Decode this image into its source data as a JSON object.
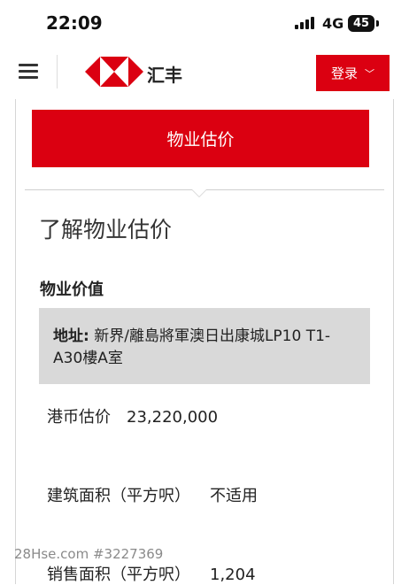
{
  "status_bar": {
    "time": "22:09",
    "network": "4G",
    "battery": "45"
  },
  "header": {
    "brand": "汇丰",
    "login_label": "登录"
  },
  "tab": {
    "label": "物业估价"
  },
  "section": {
    "title": "了解物业估价",
    "subheading": "物业价值"
  },
  "address": {
    "label": "地址:",
    "value": "新界/離島將軍澳日出康城LP10 T1-A30樓A室"
  },
  "rows": {
    "hkd_valuation": {
      "label": "港币估价",
      "value": "23,220,000"
    },
    "gross_area": {
      "label": "建筑面积（平方呎）",
      "value": "不适用"
    },
    "saleable_area": {
      "label": "销售面积（平方呎）",
      "value": "1,204"
    }
  },
  "watermark": "28Hse.com #3227369",
  "colors": {
    "brand_red": "#db0011",
    "address_bg": "#d9d9d9"
  },
  "icons": {
    "menu": "hamburger-icon",
    "logo": "hsbc-hexagon-logo",
    "login_chevron": "chevron-down-icon"
  }
}
